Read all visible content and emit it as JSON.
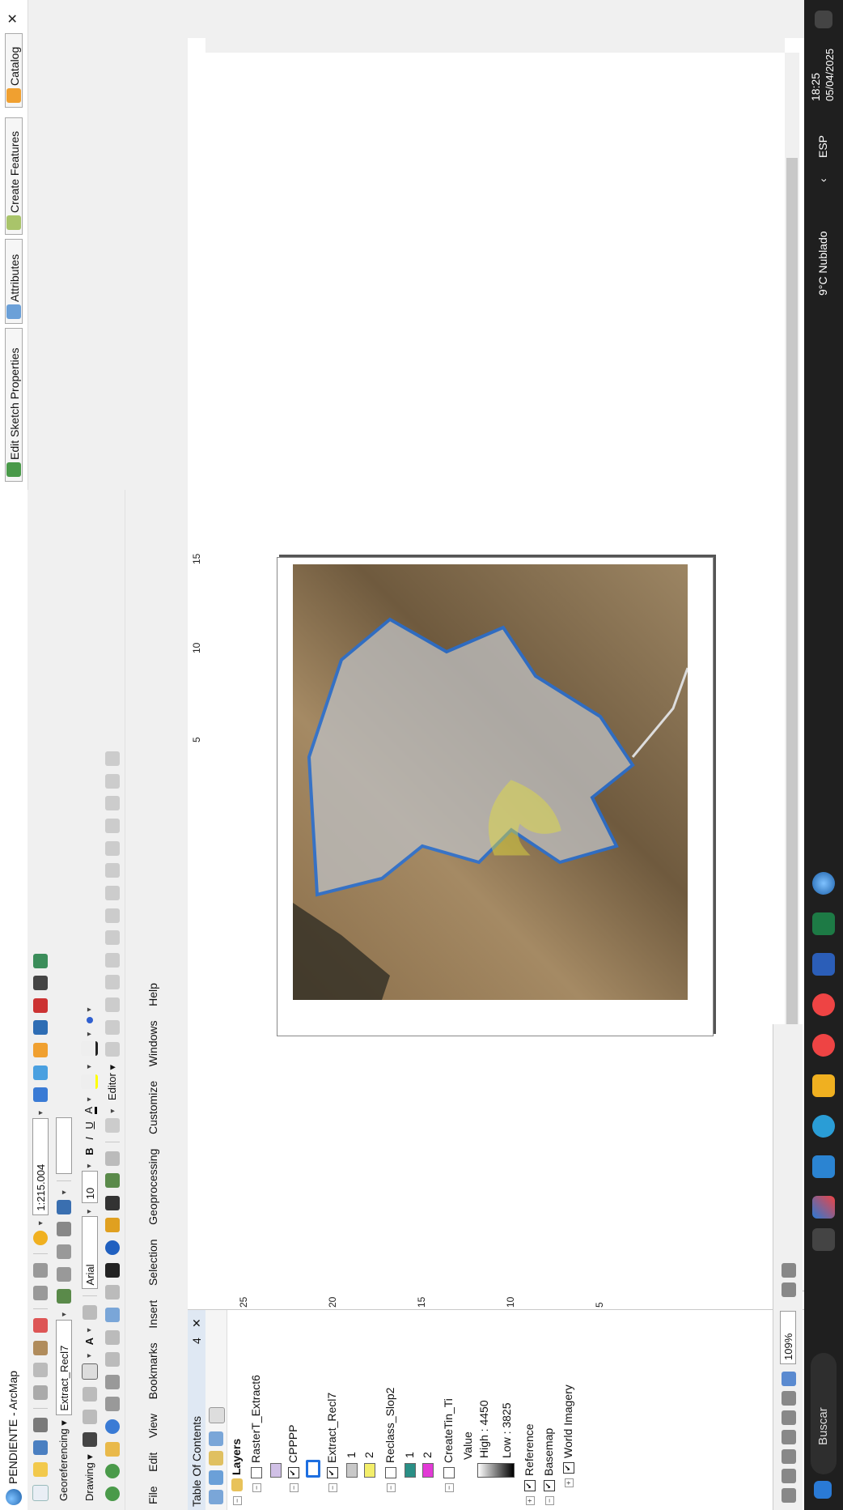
{
  "window": {
    "title": "PENDIENTE - ArcMap",
    "minimize": "—",
    "restore": "❐",
    "close": "✕"
  },
  "menubar": {
    "items": [
      "File",
      "Edit",
      "View",
      "Bookmarks",
      "Insert",
      "Selection",
      "Geoprocessing",
      "Customize",
      "Windows",
      "Help"
    ]
  },
  "toolbar_standard": {
    "scale": "1:215.004"
  },
  "toolbar_georef": {
    "label": "Georeferencing ▾",
    "layer": "Extract_Recl7"
  },
  "toolbar_drawing": {
    "label": "Drawing ▾",
    "font": "Arial",
    "size": "10",
    "bold": "B",
    "italic": "I",
    "underline": "U",
    "text_a": "A"
  },
  "toolbar_editor": {
    "label": "Editor ▾"
  },
  "editor_buttons": {
    "sketch": "Edit Sketch Properties",
    "attributes": "Attributes",
    "create": "Create Features",
    "catalog": "Catalog"
  },
  "toc": {
    "title": "Table Of Contents",
    "pin": "4",
    "close": "✕",
    "root": "Layers",
    "rows": [
      {
        "name": "RasterT_Extract6",
        "checked": false,
        "indent": 1
      },
      {
        "name": "CPPPP",
        "checked": true,
        "indent": 1
      },
      {
        "name": "Extract_Recl7",
        "checked": true,
        "indent": 1
      },
      {
        "name": "1",
        "indent": 2,
        "swatch": "#c8c8c8"
      },
      {
        "name": "2",
        "indent": 2,
        "swatch": "#f3ee6a"
      },
      {
        "name": "Reclass_Slop2",
        "checked": false,
        "indent": 1
      },
      {
        "name": "1",
        "indent": 2,
        "swatch": "#2a8f86"
      },
      {
        "name": "2",
        "indent": 2,
        "swatch": "#e23ad6"
      },
      {
        "name": "CreateTin_Ti",
        "checked": false,
        "indent": 1
      },
      {
        "name": "Value",
        "indent": 3
      },
      {
        "name": "High : 4450",
        "indent": 3
      },
      {
        "name": "Low : 3825",
        "indent": 3
      },
      {
        "name": "Reference",
        "checked": true,
        "indent": 1
      },
      {
        "name": "Basemap",
        "checked": true,
        "indent": 1
      },
      {
        "name": "World Imagery",
        "checked": true,
        "indent": 2
      }
    ]
  },
  "rulers": {
    "top_ticks": [
      "5",
      "10",
      "15"
    ],
    "left_ticks": [
      "25",
      "20",
      "15",
      "10",
      "5"
    ]
  },
  "statusbar": {
    "zoom": "109%"
  },
  "taskbar": {
    "search": "Buscar",
    "weather": "9°C  Nublado",
    "lang": "ESP",
    "time": "18:25",
    "date": "05/04/2025"
  },
  "colors": {
    "accent": "#1a74e8",
    "boundary": "#1e6fe0",
    "highlight": "#e6e03a"
  }
}
